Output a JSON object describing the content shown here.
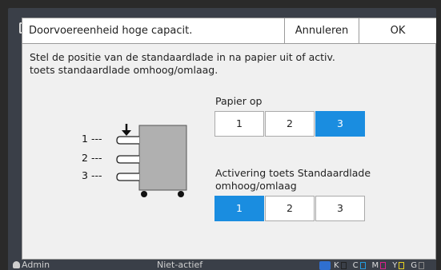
{
  "dialog": {
    "title": "Doorvoereenheid hoge capacit.",
    "cancel_label": "Annuleren",
    "ok_label": "OK",
    "instruction_lines": [
      "Stel de positie van de standaardlade in na papier uit of activ.",
      "toets standaardlade omhoog/omlaag."
    ]
  },
  "diagram": {
    "levels": [
      "1",
      "2",
      "3"
    ],
    "dash": "---",
    "arrow": "down-arrow-icon"
  },
  "paper_out": {
    "label": "Papier op",
    "options": [
      "1",
      "2",
      "3"
    ],
    "selected": "3"
  },
  "tray_toggle": {
    "label_lines": [
      "Activering toets Standaardlade",
      "omhoog/omlaag"
    ],
    "options": [
      "1",
      "2",
      "3"
    ],
    "selected": "1"
  },
  "status_bar": {
    "user": "Admin",
    "state": "Niet-actief",
    "inks": [
      "K",
      "C",
      "M",
      "Y",
      "G"
    ],
    "ink_colors": [
      "#222222",
      "#22a0e0",
      "#e0208a",
      "#e6d020",
      "#888888"
    ]
  },
  "colors": {
    "accent": "#1a8de0",
    "background": "#3a3f48"
  }
}
